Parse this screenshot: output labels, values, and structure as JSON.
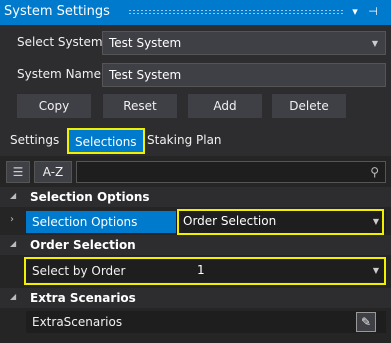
{
  "window": {
    "title": "System Settings"
  },
  "form": {
    "select_system_label": "Select System:",
    "select_system_value": "Test System",
    "system_name_label": "System Name:",
    "system_name_value": "Test System"
  },
  "buttons": {
    "copy": "Copy",
    "reset": "Reset",
    "add": "Add",
    "delete": "Delete"
  },
  "tabs": [
    {
      "label": "Settings"
    },
    {
      "label": "Selections"
    },
    {
      "label": "Staking Plan"
    }
  ],
  "toolbar": {
    "sort_label": "A-Z"
  },
  "grid": {
    "categories": [
      {
        "name": "Selection Options"
      },
      {
        "name": "Order Selection"
      },
      {
        "name": "Extra Scenarios"
      }
    ],
    "rows": [
      {
        "property": "Selection Options",
        "value": "Order Selection"
      },
      {
        "property": "Select by Order",
        "value": "1"
      },
      {
        "property": "ExtraScenarios",
        "value": ""
      }
    ]
  },
  "colors": {
    "accent": "#007acc",
    "highlight": "#f0f000",
    "background": "#2d2d30"
  }
}
